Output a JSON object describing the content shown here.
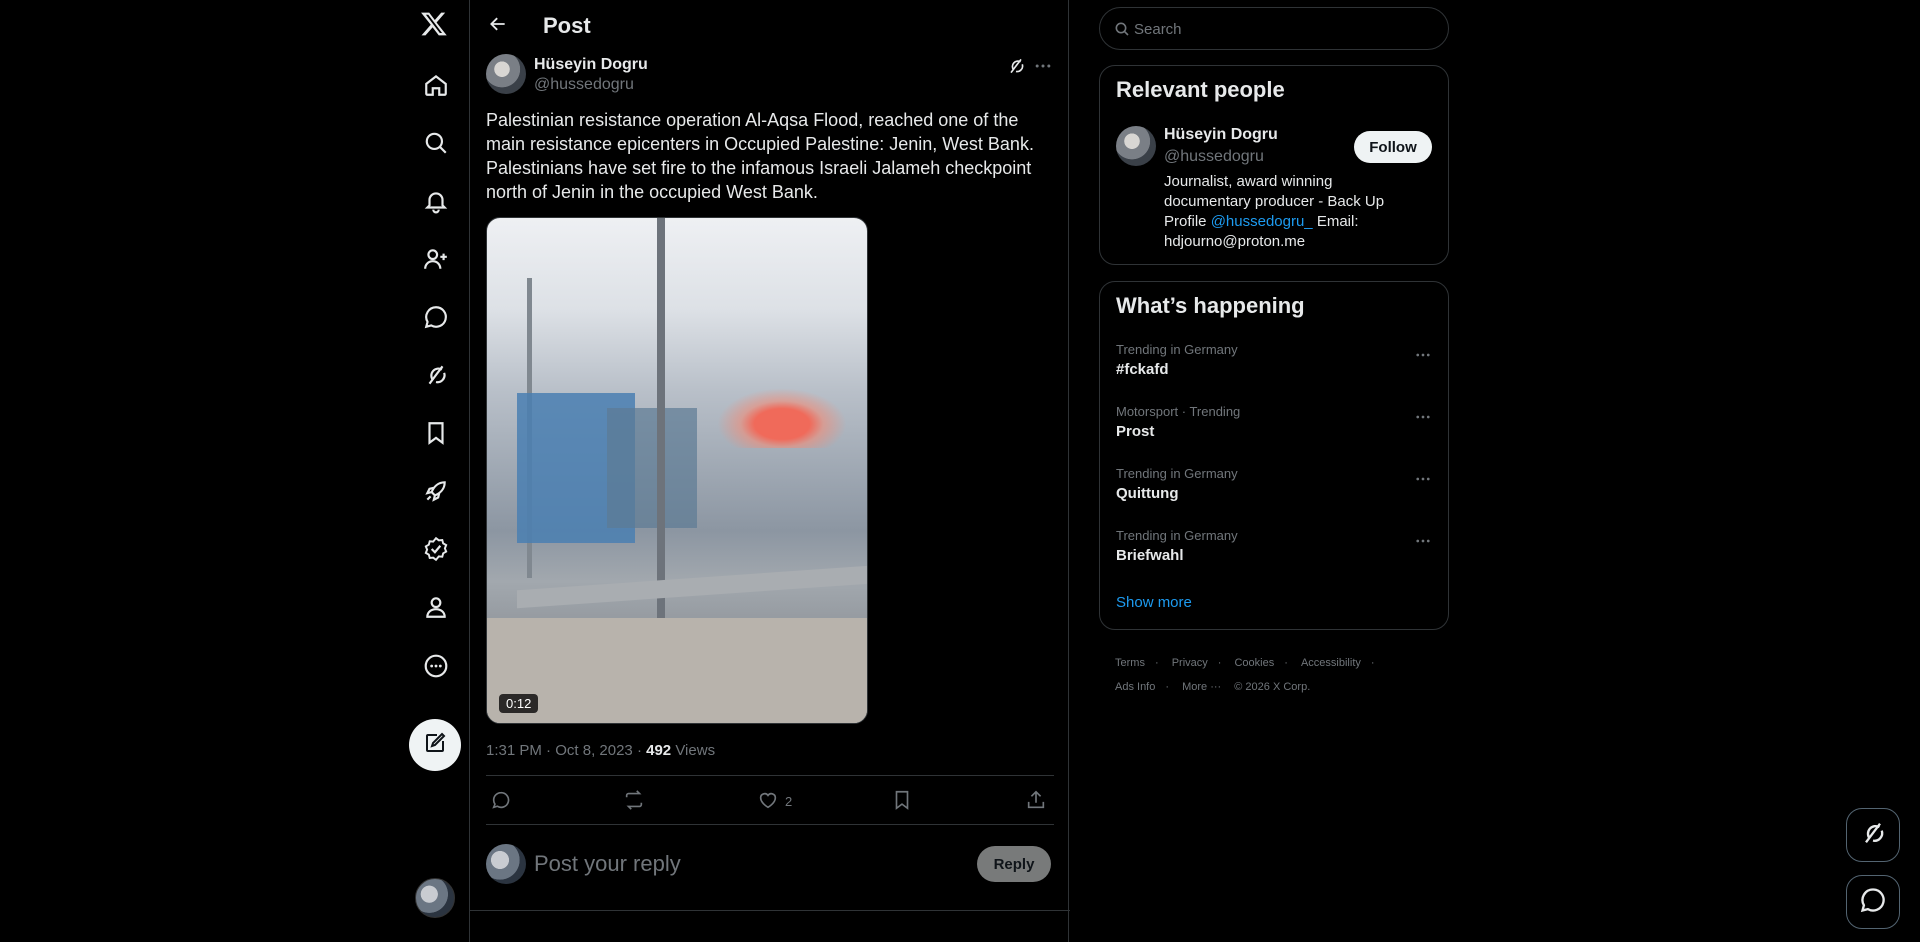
{
  "nav": {
    "items": [
      "Home",
      "Explore",
      "Notifications",
      "Follow",
      "Chat",
      "Grok",
      "Bookmarks",
      "Premium",
      "Verified Orgs",
      "Profile",
      "More"
    ],
    "icons": [
      "home-icon",
      "search-icon",
      "bell-icon",
      "person-add-icon",
      "chat-bubble-icon",
      "grok-icon",
      "bookmark-icon",
      "rocket-icon",
      "verified-badge-icon",
      "person-icon",
      "more-circle-icon"
    ]
  },
  "header": {
    "title": "Post"
  },
  "post": {
    "author_name": "Hüseyin Dogru",
    "author_handle": "@hussedogru",
    "text": "Palestinian resistance operation Al-Aqsa Flood, reached one of the main resistance epicenters in Occupied Palestine: Jenin, West Bank. Palestinians have set fire to the infamous Israeli Jalameh checkpoint north of Jenin in the occupied West Bank.",
    "video_duration": "0:12",
    "time": "1:31 PM",
    "date": "Oct 8, 2023",
    "views_count": "492",
    "views_label": "Views",
    "likes": "2"
  },
  "reply": {
    "placeholder": "Post your reply",
    "button": "Reply"
  },
  "search": {
    "placeholder": "Search"
  },
  "relevant": {
    "title": "Relevant people",
    "name": "Hüseyin Dogru",
    "handle": "@hussedogru",
    "follow": "Follow",
    "bio_before": "Journalist, award winning documentary producer - Back Up Profile ",
    "bio_link": "@hussedogru_",
    "bio_after": " Email: hdjourno@proton.me"
  },
  "trends": {
    "title": "What’s happening",
    "items": [
      {
        "context": "Trending in Germany",
        "topic": "#fckafd"
      },
      {
        "context": "Motorsport · Trending",
        "topic": "Prost"
      },
      {
        "context": "Trending in Germany",
        "topic": "Quittung"
      },
      {
        "context": "Trending in Germany",
        "topic": "Briefwahl"
      }
    ],
    "show_more": "Show more"
  },
  "footer": {
    "links": [
      "Terms",
      "Privacy",
      "Cookies",
      "Accessibility",
      "Ads Info",
      "More ···"
    ],
    "copyright": "© 2026 X Corp."
  },
  "colors": {
    "accent": "#1d9bf0",
    "background": "#000000",
    "border": "#2f3336",
    "muted": "#71767b",
    "text": "#e7e9ea"
  }
}
